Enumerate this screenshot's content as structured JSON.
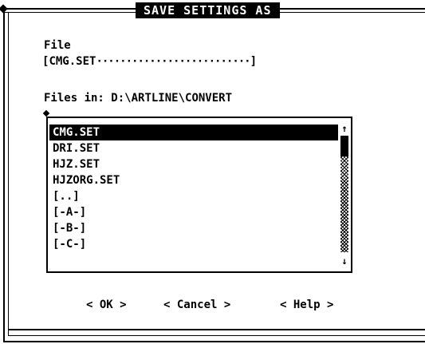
{
  "dialog": {
    "title": "SAVE SETTINGS AS"
  },
  "file": {
    "label": "File",
    "value": "CMG.SET",
    "fill": "··························",
    "open_bracket": "[",
    "close_bracket": "]"
  },
  "directory": {
    "label": "Files in:",
    "path": "D:\\ARTLINE\\CONVERT"
  },
  "file_list": {
    "items": [
      {
        "label": "CMG.SET",
        "selected": true
      },
      {
        "label": "DRI.SET",
        "selected": false
      },
      {
        "label": "HJZ.SET",
        "selected": false
      },
      {
        "label": "HJZORG.SET",
        "selected": false
      },
      {
        "label": "[..]",
        "selected": false
      },
      {
        "label": "[-A-]",
        "selected": false
      },
      {
        "label": "[-B-]",
        "selected": false
      },
      {
        "label": "[-C-]",
        "selected": false
      }
    ],
    "scroll_up_glyph": "↑",
    "scroll_down_glyph": "↓"
  },
  "buttons": {
    "ok": "< OK >",
    "cancel": "< Cancel >",
    "help": "< Help >"
  },
  "icons": {
    "close": "diamond-icon",
    "list_marker": "diamond-icon"
  },
  "colors": {
    "foreground": "#000000",
    "background": "#ffffff",
    "selection_bg": "#000000",
    "selection_fg": "#ffffff"
  }
}
